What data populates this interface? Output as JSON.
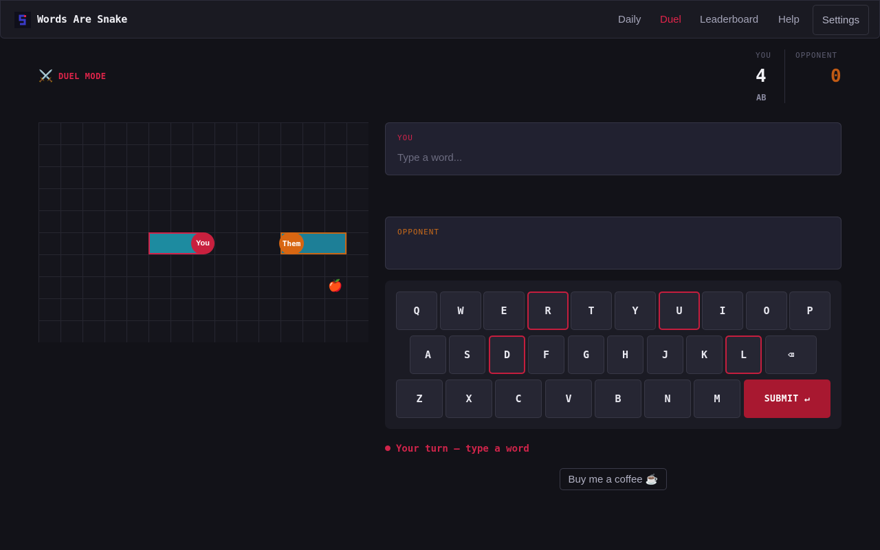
{
  "app": {
    "title": "Words Are Snake",
    "logo_icon": "snake-logo-icon"
  },
  "nav": {
    "items": [
      {
        "label": "Daily",
        "active": false
      },
      {
        "label": "Duel",
        "active": true
      },
      {
        "label": "Leaderboard",
        "active": false
      },
      {
        "label": "Help",
        "active": false
      }
    ],
    "settings_label": "Settings"
  },
  "mode": {
    "icon": "crossed-swords-icon",
    "icon_glyph": "⚔️",
    "label": "DUEL MODE"
  },
  "scores": {
    "you_label": "YOU",
    "you_score": "4",
    "you_initials": "AB",
    "opponent_label": "OPPONENT",
    "opponent_score": "0"
  },
  "board": {
    "you_head_label": "You",
    "opponent_head_label": "Them",
    "apple_icon": "apple-icon",
    "apple_glyph": "🍎"
  },
  "word_panels": {
    "you_label": "YOU",
    "you_placeholder": "Type a word...",
    "you_value": "",
    "opponent_label": "OPPONENT",
    "opponent_value": ""
  },
  "keyboard": {
    "rows": [
      [
        "Q",
        "W",
        "E",
        "R",
        "T",
        "Y",
        "U",
        "I",
        "O",
        "P"
      ],
      [
        "A",
        "S",
        "D",
        "F",
        "G",
        "H",
        "J",
        "K",
        "L"
      ],
      [
        "Z",
        "X",
        "C",
        "V",
        "B",
        "N",
        "M"
      ]
    ],
    "highlighted_keys": [
      "R",
      "U",
      "D",
      "L"
    ],
    "backspace_glyph": "⌫",
    "submit_label": "SUBMIT ↵"
  },
  "status": {
    "text": "Your turn — type a word"
  },
  "coffee": {
    "label": "Buy me a coffee ☕"
  },
  "colors": {
    "accent_red": "#e0244a",
    "opponent_orange": "#d86612",
    "snake_body_teal": "#1d8ba0",
    "background": "#121218"
  }
}
